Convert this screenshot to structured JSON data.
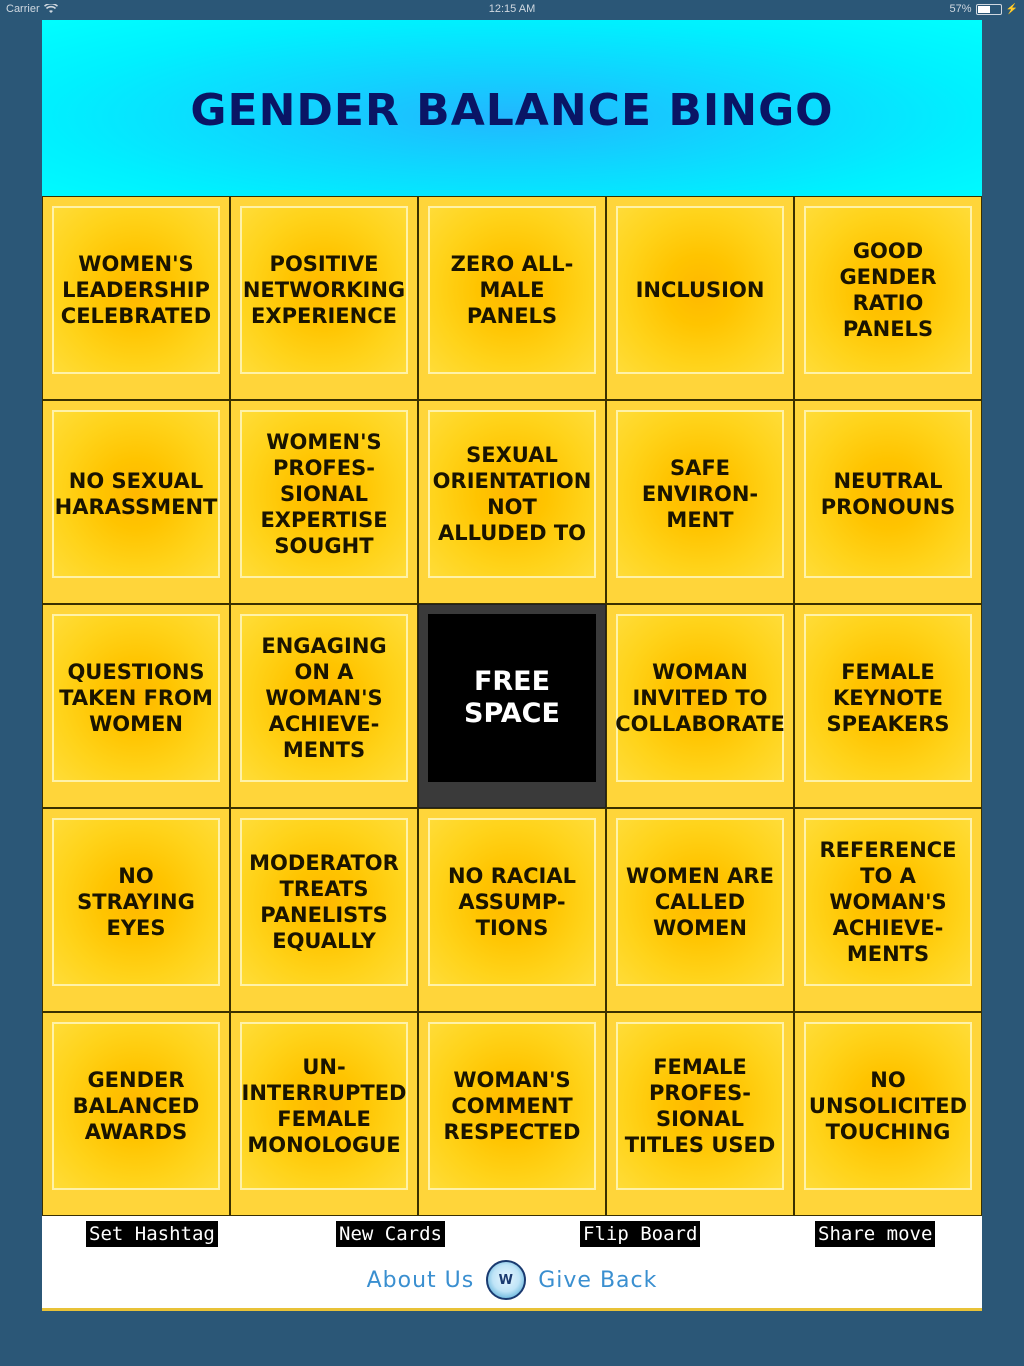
{
  "status": {
    "carrier": "Carrier",
    "time": "12:15 AM",
    "battery": "57%",
    "battery_level": 0.57
  },
  "header": {
    "title": "GENDER BALANCE BINGO"
  },
  "board": {
    "cells": [
      "WOMEN'S LEADERSHIP CELEBRATED",
      "POSITIVE NETWORKING EXPERIENCE",
      "ZERO ALL-MALE PANELS",
      "INCLUSION",
      "GOOD GENDER RATIO PANELS",
      "NO SEXUAL HARASSMENT",
      "WOMEN'S PROFES-SIONAL EXPERTISE SOUGHT",
      "SEXUAL ORIENTATION NOT ALLUDED TO",
      "SAFE ENVIRON-MENT",
      "NEUTRAL PRONOUNS",
      "QUESTIONS TAKEN FROM WOMEN",
      "ENGAGING ON A WOMAN'S ACHIEVE-MENTS",
      "FREE SPACE",
      "WOMAN INVITED TO COLLABORATE",
      "FEMALE KEYNOTE SPEAKERS",
      "NO STRAYING EYES",
      "MODERATOR TREATS PANELISTS EQUALLY",
      "NO RACIAL ASSUMP-TIONS",
      "WOMEN ARE CALLED WOMEN",
      "REFERENCE TO A WOMAN'S ACHIEVE-MENTS",
      "GENDER BALANCED AWARDS",
      "UN-INTERRUPTED FEMALE MONOLOGUE",
      "WOMAN'S COMMENT RESPECTED",
      "FEMALE PROFES-SIONAL TITLES USED",
      "NO UNSOLICITED TOUCHING"
    ]
  },
  "footer": {
    "set_hashtag": "Set Hashtag",
    "new_cards": "New Cards",
    "flip_board": "Flip Board",
    "share_move": "Share move",
    "about_us": "About Us",
    "logo_text": "W",
    "give_back": "Give Back"
  },
  "colors": {
    "background": "#2b5777",
    "header_bg": "#00f0ff",
    "title": "#0a1565",
    "tile": "#ffc400",
    "free_tile": "#000000",
    "link": "#3a8fd0"
  }
}
